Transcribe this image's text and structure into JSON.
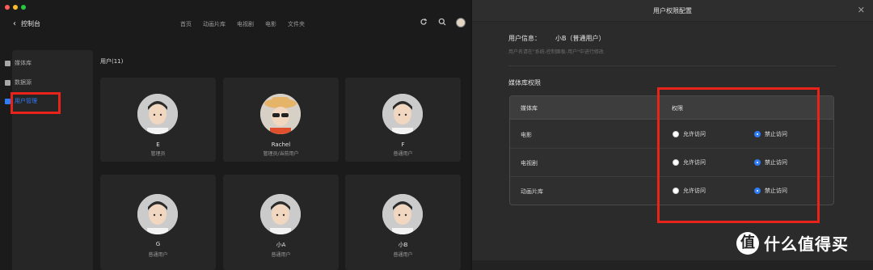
{
  "left": {
    "back_label": "控制台",
    "nav": [
      "首页",
      "动画片库",
      "电视剧",
      "电影",
      "文件夹"
    ],
    "icons": [
      "refresh-icon",
      "search-icon",
      "user-avatar-icon"
    ],
    "sidebar": [
      {
        "label": "媒体库",
        "active": false
      },
      {
        "label": "数据源",
        "active": false
      },
      {
        "label": "用户管理",
        "active": true
      }
    ],
    "users_title": "用户(11)",
    "users": [
      {
        "name": "E",
        "role": "管理员"
      },
      {
        "name": "Rachel",
        "role": "管理员/当前用户"
      },
      {
        "name": "F",
        "role": "普通用户"
      },
      {
        "name": "G",
        "role": "普通用户"
      },
      {
        "name": "小A",
        "role": "普通用户"
      },
      {
        "name": "小B",
        "role": "普通用户"
      }
    ]
  },
  "dialog": {
    "title": "用户权限配置",
    "user_info_label": "用户信息：",
    "user_info_value": "小B（普通用户）",
    "hint": "用户名请在\"系统-控制面板-用户\"中进行修改",
    "section_title": "媒体库权限",
    "table": {
      "col_library": "媒体库",
      "col_permission": "权限",
      "allow_label": "允许访问",
      "deny_label": "禁止访问",
      "rows": [
        {
          "library": "电影",
          "selected": "deny"
        },
        {
          "library": "电视剧",
          "selected": "deny"
        },
        {
          "library": "动画片库",
          "selected": "deny"
        }
      ]
    }
  },
  "watermark": {
    "logo": "值",
    "text": "什么值得买"
  },
  "colors": {
    "accent": "#2f7cf6",
    "highlight": "#e8231a"
  }
}
